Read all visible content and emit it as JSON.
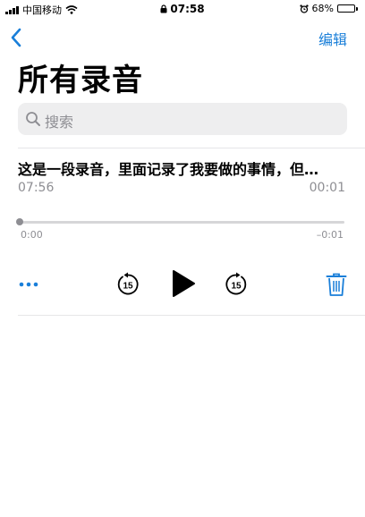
{
  "status_bar": {
    "carrier": "中国移动",
    "time": "07:58",
    "battery_text": "68%",
    "battery_level": 0.68
  },
  "nav": {
    "back_icon": "chevron-left-icon",
    "edit_label": "编辑"
  },
  "page_title": "所有录音",
  "search": {
    "placeholder": "搜索"
  },
  "recording": {
    "title": "这是一段录音，里面记录了我要做的事情，但…",
    "time": "07:56",
    "duration": "00:01",
    "elapsed": "0:00",
    "remaining": "–0:01",
    "progress": 0.0,
    "skip_seconds": "15"
  },
  "colors": {
    "accent": "#1a7fd9",
    "secondary_text": "#8e8e93",
    "search_bg": "#eeeeef"
  }
}
